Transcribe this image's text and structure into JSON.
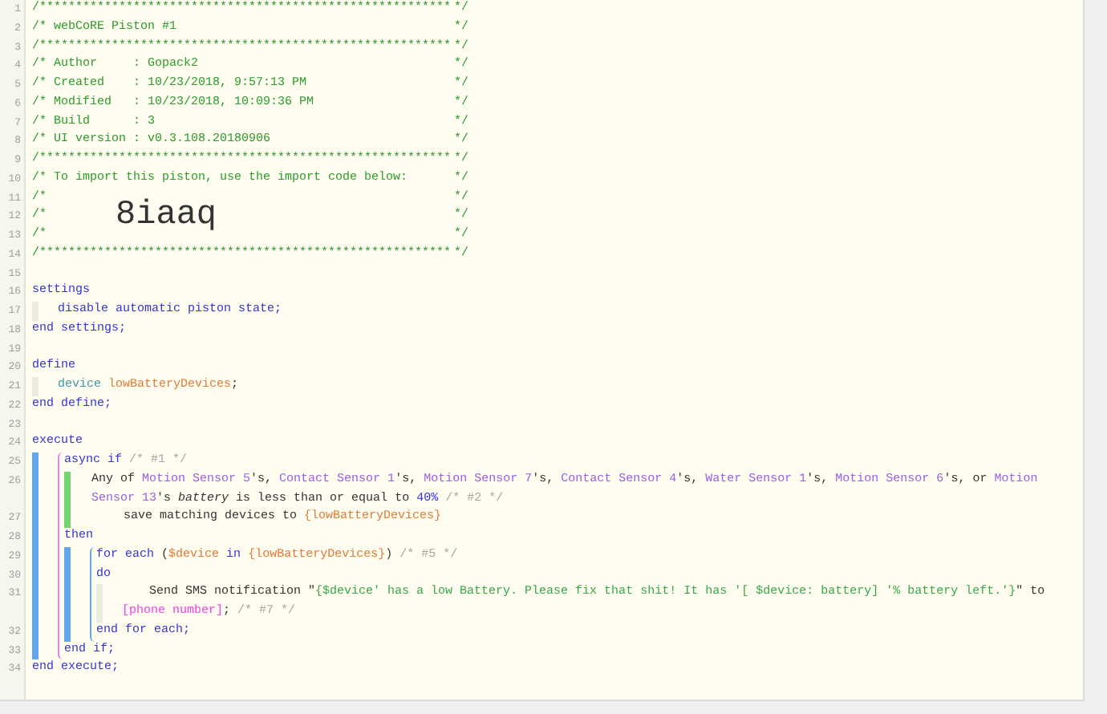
{
  "editor": {
    "lines": [
      {
        "kind": "banner",
        "number": "1",
        "segments": [
          {
            "kind": "comment",
            "text": "/*********************************************************"
          },
          {
            "kind": "comment-end",
            "text": "*/"
          }
        ]
      },
      {
        "kind": "banner",
        "number": "2",
        "segments": [
          {
            "kind": "comment",
            "text": "/* webCoRE Piston #1"
          },
          {
            "kind": "comment-end",
            "text": "*/"
          }
        ]
      },
      {
        "kind": "banner",
        "number": "3",
        "segments": [
          {
            "kind": "comment",
            "text": "/*********************************************************"
          },
          {
            "kind": "comment-end",
            "text": "*/"
          }
        ]
      },
      {
        "kind": "banner",
        "number": "4",
        "segments": [
          {
            "kind": "comment",
            "text": "/* Author     : Gopack2"
          },
          {
            "kind": "comment-end",
            "text": "*/"
          }
        ]
      },
      {
        "kind": "banner",
        "number": "5",
        "segments": [
          {
            "kind": "comment",
            "text": "/* Created    : 10/23/2018, 9:57:13 PM"
          },
          {
            "kind": "comment-end",
            "text": "*/"
          }
        ]
      },
      {
        "kind": "banner",
        "number": "6",
        "segments": [
          {
            "kind": "comment",
            "text": "/* Modified   : 10/23/2018, 10:09:36 PM"
          },
          {
            "kind": "comment-end",
            "text": "*/"
          }
        ]
      },
      {
        "kind": "banner",
        "number": "7",
        "segments": [
          {
            "kind": "comment",
            "text": "/* Build      : 3"
          },
          {
            "kind": "comment-end",
            "text": "*/"
          }
        ]
      },
      {
        "kind": "banner",
        "number": "8",
        "segments": [
          {
            "kind": "comment",
            "text": "/* UI version : v0.3.108.20180906"
          },
          {
            "kind": "comment-end",
            "text": "*/"
          }
        ]
      },
      {
        "kind": "banner",
        "number": "9",
        "segments": [
          {
            "kind": "comment",
            "text": "/*********************************************************"
          },
          {
            "kind": "comment-end",
            "text": "*/"
          }
        ]
      },
      {
        "kind": "banner",
        "number": "10",
        "segments": [
          {
            "kind": "comment",
            "text": "/* To import this piston, use the import code below:"
          },
          {
            "kind": "comment-end",
            "text": "*/"
          }
        ]
      },
      {
        "kind": "banner",
        "number": "11",
        "segments": [
          {
            "kind": "comment",
            "text": "/*"
          },
          {
            "kind": "comment-end",
            "text": "*/"
          }
        ]
      },
      {
        "kind": "banner",
        "number": "12",
        "segments": [
          {
            "kind": "comment",
            "text": "/*"
          },
          {
            "kind": "code",
            "text": "8iaaq"
          },
          {
            "kind": "comment-end",
            "text": "*/"
          }
        ]
      },
      {
        "kind": "banner",
        "number": "13",
        "segments": [
          {
            "kind": "comment",
            "text": "/*"
          },
          {
            "kind": "comment-end",
            "text": "*/"
          }
        ]
      },
      {
        "kind": "banner",
        "number": "14",
        "segments": [
          {
            "kind": "comment",
            "text": "/*********************************************************"
          },
          {
            "kind": "comment-end",
            "text": "*/"
          }
        ]
      },
      {
        "kind": "line",
        "number": "15"
      },
      {
        "kind": "line",
        "number": "16",
        "segments": [
          {
            "kind": "keyword",
            "text": "settings"
          }
        ],
        "block": {
          "kind": "setting",
          "children": [
            {
              "kind": "line",
              "number": "17",
              "segments": [
                {
                  "kind": "keyword",
                  "text": "disable automatic piston state;"
                }
              ]
            }
          ]
        }
      },
      {
        "kind": "line",
        "number": "18",
        "segments": [
          {
            "kind": "keyword",
            "text": "end settings;"
          }
        ]
      },
      {
        "kind": "line",
        "number": "19"
      },
      {
        "kind": "line",
        "number": "20",
        "segments": [
          {
            "kind": "keyword",
            "text": "define"
          }
        ],
        "block": {
          "kind": "setting",
          "children": [
            {
              "kind": "line",
              "number": "21",
              "segments": [
                {
                  "kind": "type",
                  "text": "device"
                },
                {
                  "kind": "variable",
                  "text": " lowBatteryDevices"
                },
                {
                  "kind": "plain",
                  "text": ";"
                }
              ]
            }
          ]
        }
      },
      {
        "kind": "line",
        "number": "22",
        "segments": [
          {
            "kind": "keyword",
            "text": "end define;"
          }
        ]
      },
      {
        "kind": "line",
        "number": "23"
      },
      {
        "kind": "line",
        "number": "24",
        "segments": [
          {
            "kind": "keyword",
            "text": "execute"
          }
        ],
        "block": {
          "kind": "statement",
          "children": [
            {
              "kind": "if",
              "children": [
                {
                  "kind": "line",
                  "number": "25",
                  "segments": [
                    {
                      "kind": "keyword",
                      "text": "async if"
                    },
                    {
                      "kind": "note",
                      "text": " /* #1 */"
                    }
                  ],
                  "block": {
                    "kind": "condition",
                    "children": [
                      {
                        "kind": "line",
                        "number": "26",
                        "segments": [
                          {
                            "kind": "plain",
                            "text": "Any of "
                          },
                          {
                            "kind": "device",
                            "text": "Motion Sensor 5"
                          },
                          {
                            "kind": "plain",
                            "text": "'s, "
                          },
                          {
                            "kind": "device",
                            "text": "Contact Sensor 1"
                          },
                          {
                            "kind": "plain",
                            "text": "'s, "
                          },
                          {
                            "kind": "device",
                            "text": "Motion Sensor 7"
                          },
                          {
                            "kind": "plain",
                            "text": "'s, "
                          },
                          {
                            "kind": "device",
                            "text": "Contact Sensor 4"
                          },
                          {
                            "kind": "plain",
                            "text": "'s, "
                          },
                          {
                            "kind": "device",
                            "text": "Water Sensor 1"
                          },
                          {
                            "kind": "plain",
                            "text": "'s, "
                          },
                          {
                            "kind": "device",
                            "text": "Motion Sensor 6"
                          },
                          {
                            "kind": "plain",
                            "text": "'s, or "
                          },
                          {
                            "kind": "device",
                            "text": "Motion Sensor 13"
                          },
                          {
                            "kind": "plain",
                            "text": "'s "
                          },
                          {
                            "kind": "italic",
                            "text": "battery"
                          },
                          {
                            "kind": "plain",
                            "text": " is less than or equal to "
                          },
                          {
                            "kind": "number",
                            "text": "40%"
                          },
                          {
                            "kind": "note",
                            "text": " /* #2 */"
                          }
                        ],
                        "block": {
                          "kind": "none",
                          "children": [
                            {
                              "kind": "line",
                              "number": "27",
                              "segments": [
                                {
                                  "kind": "plain",
                                  "text": "save matching devices to "
                                },
                                {
                                  "kind": "variable",
                                  "text": "{lowBatteryDevices}"
                                }
                              ]
                            }
                          ]
                        }
                      }
                    ]
                  }
                },
                {
                  "kind": "line",
                  "number": "28",
                  "segments": [
                    {
                      "kind": "keyword",
                      "text": "then"
                    }
                  ],
                  "block": {
                    "kind": "statement",
                    "children": [
                      {
                        "kind": "loop",
                        "children": [
                          {
                            "kind": "line",
                            "number": "29",
                            "segments": [
                              {
                                "kind": "keyword",
                                "text": "for each"
                              },
                              {
                                "kind": "plain",
                                "text": " ("
                              },
                              {
                                "kind": "variable",
                                "text": "$device"
                              },
                              {
                                "kind": "keyword",
                                "text": " in "
                              },
                              {
                                "kind": "variable",
                                "text": "{lowBatteryDevices}"
                              },
                              {
                                "kind": "plain",
                                "text": ")"
                              },
                              {
                                "kind": "note",
                                "text": " /* #5 */"
                              }
                            ]
                          },
                          {
                            "kind": "line",
                            "number": "30",
                            "segments": [
                              {
                                "kind": "keyword",
                                "text": "do"
                              }
                            ],
                            "block": {
                              "kind": "task",
                              "children": [
                                {
                                  "kind": "line",
                                  "number": "31",
                                  "segments": [
                                    {
                                      "kind": "plain",
                                      "text": "Send SMS notification \""
                                    },
                                    {
                                      "kind": "string",
                                      "text": "{$device' has a low Battery. Please fix that shit! It has '[ $device: battery] '% battery left.'}"
                                    },
                                    {
                                      "kind": "plain",
                                      "text": "\" to "
                                    },
                                    {
                                      "kind": "argument",
                                      "text": "[phone number]"
                                    },
                                    {
                                      "kind": "plain",
                                      "text": ";"
                                    },
                                    {
                                      "kind": "note",
                                      "text": " /* #7 */"
                                    }
                                  ]
                                }
                              ]
                            }
                          },
                          {
                            "kind": "line",
                            "number": "32",
                            "segments": [
                              {
                                "kind": "keyword",
                                "text": "end for each;"
                              }
                            ]
                          }
                        ]
                      }
                    ]
                  }
                },
                {
                  "kind": "line",
                  "number": "33",
                  "segments": [
                    {
                      "kind": "keyword",
                      "text": "end if;"
                    }
                  ]
                }
              ]
            }
          ]
        }
      },
      {
        "kind": "line",
        "number": "34",
        "segments": [
          {
            "kind": "keyword",
            "text": "end execute;"
          }
        ]
      }
    ]
  }
}
